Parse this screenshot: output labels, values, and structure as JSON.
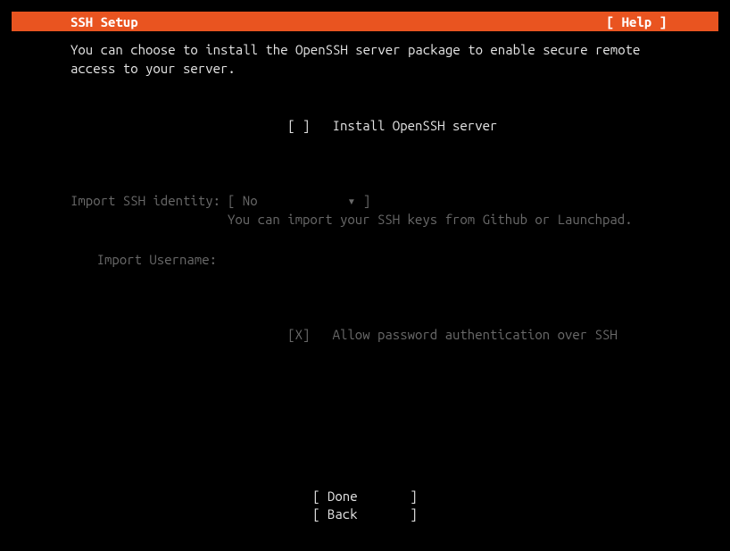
{
  "header": {
    "title": "SSH Setup",
    "help": "[ Help ]"
  },
  "description": "You can choose to install the OpenSSH server package to enable secure remote\naccess to your server.",
  "install": {
    "checkbox": "[ ]",
    "label": "Install OpenSSH server"
  },
  "identity": {
    "label": "Import SSH identity:",
    "dropdown": "[ No            ▾ ]",
    "helper": "You can import your SSH keys from Github or Launchpad."
  },
  "username": {
    "label": "Import Username:"
  },
  "password_auth": {
    "checkbox": "[X]",
    "label": "Allow password authentication over SSH"
  },
  "footer": {
    "done": "[ Done       ]",
    "back": "[ Back       ]"
  }
}
